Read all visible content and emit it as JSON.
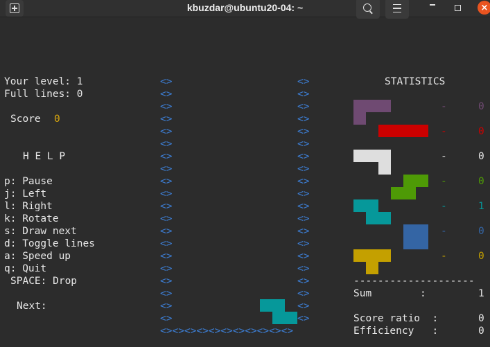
{
  "window": {
    "title": "kbuzdar@ubuntu20-04: ~",
    "close_glyph": "×"
  },
  "left": {
    "level_label": "Your level: 1",
    "lines_label": "Full lines: 0",
    "score_label": "Score",
    "score_value": "0",
    "help_title": "H E L P",
    "help": [
      "p: Pause",
      "j: Left",
      "l: Right",
      "k: Rotate",
      "s: Draw next",
      "d: Toggle lines",
      "a: Speed up",
      "q: Quit",
      "SPACE: Drop"
    ],
    "next_label": "Next:"
  },
  "board": {
    "wall": "<>",
    "floor": "<><><><><><><><><><><>"
  },
  "statistics": {
    "title": "STATISTICS",
    "rows": [
      {
        "piece": "L-purple",
        "dash": "-",
        "count": "0",
        "color": "#6f4a72"
      },
      {
        "piece": "I-red",
        "dash": "-",
        "count": "0",
        "color": "#cc0000"
      },
      {
        "piece": "J-white",
        "dash": "-",
        "count": "0",
        "color": "#dedede"
      },
      {
        "piece": "S-green",
        "dash": "-",
        "count": "0",
        "color": "#4e9a06"
      },
      {
        "piece": "Z-cyan",
        "dash": "-",
        "count": "1",
        "color": "#06989a"
      },
      {
        "piece": "O-blue",
        "dash": "-",
        "count": "0",
        "color": "#3465a4"
      },
      {
        "piece": "T-yellow",
        "dash": "-",
        "count": "0",
        "color": "#c4a000"
      }
    ],
    "separator": "--------------------",
    "sum_label": "Sum        :",
    "sum_value": "1",
    "ratio_label": "Score ratio  :",
    "ratio_value": "0",
    "eff_label": "Efficiency   :",
    "eff_value": "0"
  },
  "colors": {
    "background": "#2c2c2c",
    "accent_yellow": "#d9a70e",
    "wall_blue": "#3d7fd6",
    "falling_piece": "#06989a",
    "close_button": "#e95420"
  }
}
